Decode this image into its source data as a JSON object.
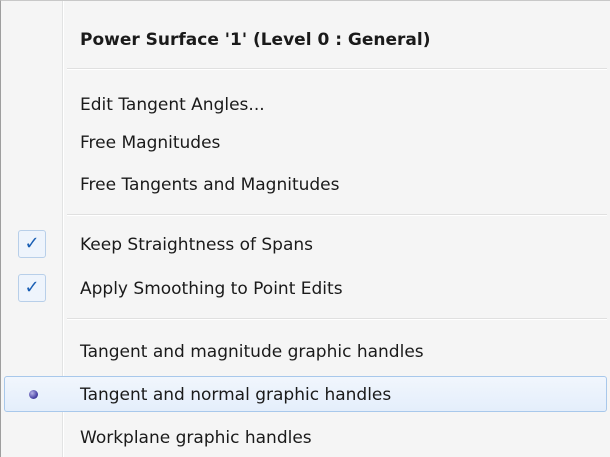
{
  "menu": {
    "header": "Power Surface '1' (Level 0 : General)",
    "items": [
      {
        "label": "Edit Tangent Angles..."
      },
      {
        "label": "Free Magnitudes"
      },
      {
        "label": "Free Tangents and Magnitudes"
      },
      {
        "label": "Keep Straightness of Spans",
        "checked": true,
        "check_glyph": "✓"
      },
      {
        "label": "Apply Smoothing to Point Edits",
        "checked": true,
        "check_glyph": "✓"
      },
      {
        "label": "Tangent and magnitude graphic handles",
        "selected": false
      },
      {
        "label": "Tangent and normal graphic handles",
        "selected": true
      },
      {
        "label": "Workplane graphic handles",
        "selected": false
      }
    ]
  },
  "colors": {
    "menu_bg": "#f5f5f5",
    "check": "#1a5fb4",
    "hover_border": "#a8c8eb"
  }
}
